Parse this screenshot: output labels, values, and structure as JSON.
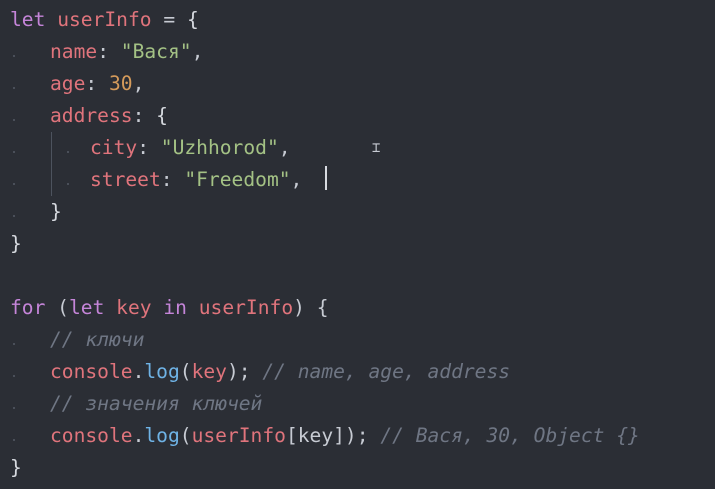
{
  "code": {
    "l1": {
      "kw": "let",
      "name": "userInfo",
      "eq": " = ",
      "open": "{"
    },
    "l2": {
      "key": "name",
      "colon": ": ",
      "value": "\"Вася\"",
      "comma": ","
    },
    "l3": {
      "key": "age",
      "colon": ": ",
      "value": "30",
      "comma": ","
    },
    "l4": {
      "key": "address",
      "colon": ": ",
      "open": "{"
    },
    "l5": {
      "key": "city",
      "colon": ": ",
      "value": "\"Uzhhorod\"",
      "comma": ","
    },
    "l6": {
      "key": "street",
      "colon": ": ",
      "value": "\"Freedom\"",
      "comma": ","
    },
    "l7": {
      "close": "}"
    },
    "l8": {
      "close": "}"
    },
    "l10": {
      "kw1": "for",
      "paren": " (",
      "kw2": "let",
      "key": "key",
      "in": "in",
      "obj": "userInfo",
      "tail": ") {"
    },
    "l11": {
      "comment": "// ключи"
    },
    "l12": {
      "obj": "console",
      "dot": ".",
      "method": "log",
      "args": "(key);",
      "comment": "// name, age, address"
    },
    "l13": {
      "comment": "// значения ключей"
    },
    "l14": {
      "obj": "console",
      "dot": ".",
      "method": "log",
      "open": "(",
      "target": "userInfo",
      "bracket": "[key]",
      "close": ");",
      "comment": "// Вася, 30, Object {}"
    },
    "l15": {
      "close": "}"
    }
  }
}
